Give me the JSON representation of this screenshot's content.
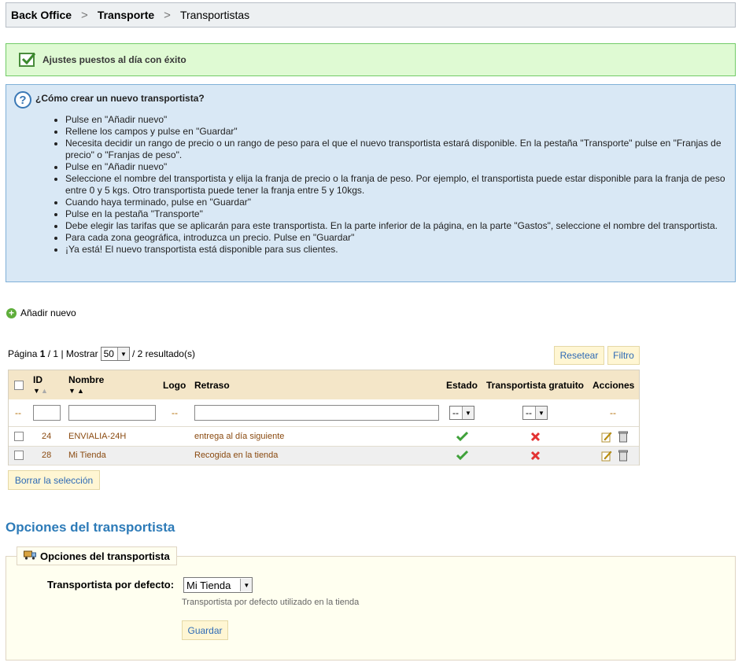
{
  "breadcrumb": {
    "items": [
      "Back Office",
      "Transporte",
      "Transportistas"
    ],
    "separator": ">"
  },
  "success": {
    "text": "Ajustes puestos al día con éxito"
  },
  "help": {
    "title": "¿Cómo crear un nuevo transportista?",
    "steps": [
      "Pulse en \"Añadir nuevo\"",
      "Rellene los campos y pulse en \"Guardar\"",
      "Necesita decidir un rango de precio o un rango de peso para el que el nuevo transportista estará disponible. En la pestaña \"Transporte\" pulse en \"Franjas de precio\" o \"Franjas de peso\".",
      "Pulse en \"Añadir nuevo\"",
      "Seleccione el nombre del transportista y elija la franja de precio o la franja de peso. Por ejemplo, el transportista puede estar disponible para la franja de peso entre 0 y 5 kgs. Otro transportista puede tener la franja entre 5 y 10kgs.",
      "Cuando haya terminado, pulse en \"Guardar\"",
      "Pulse en la pestaña \"Transporte\"",
      "Debe elegir las tarifas que se aplicarán para este transportista. En la parte inferior de la página, en la parte \"Gastos\", seleccione el nombre del transportista.",
      "Para cada zona geográfica, introduzca un precio. Pulse en \"Guardar\"",
      "¡Ya está! El nuevo transportista está disponible para sus clientes."
    ]
  },
  "actions": {
    "add_new": "Añadir nuevo"
  },
  "pagination": {
    "page_label": "Página",
    "current_page": "1",
    "total_pages": "1",
    "show_label": "Mostrar",
    "per_page": "50",
    "results": "/ 2 resultado(s)",
    "reset_label": "Resetear",
    "filter_label": "Filtro"
  },
  "table": {
    "headers": {
      "id": "ID",
      "name": "Nombre",
      "logo": "Logo",
      "delay": "Retraso",
      "status": "Estado",
      "free": "Transportista gratuito",
      "actions": "Acciones"
    },
    "filter_dash": "--",
    "select_dash": "--",
    "rows": [
      {
        "id": "24",
        "name": "ENVIALIA-24H",
        "delay": "entrega al día siguiente",
        "active": true,
        "free": false
      },
      {
        "id": "28",
        "name": "Mi Tienda",
        "delay": "Recogida en la tienda",
        "active": true,
        "free": false
      }
    ],
    "bulk_delete_label": "Borrar la selección"
  },
  "carrier_options": {
    "heading": "Opciones del transportista",
    "legend": "Opciones del transportista",
    "default_label": "Transportista por defecto:",
    "default_value": "Mi Tienda",
    "hint": "Transportista por defecto utilizado en la tienda",
    "save_label": "Guardar"
  },
  "colors": {
    "link_blue": "#2d7bb8",
    "success_green": "#dffad3",
    "info_blue": "#d9e8f5",
    "table_header": "#f4e6c8",
    "button_bg": "#fff6d3"
  }
}
